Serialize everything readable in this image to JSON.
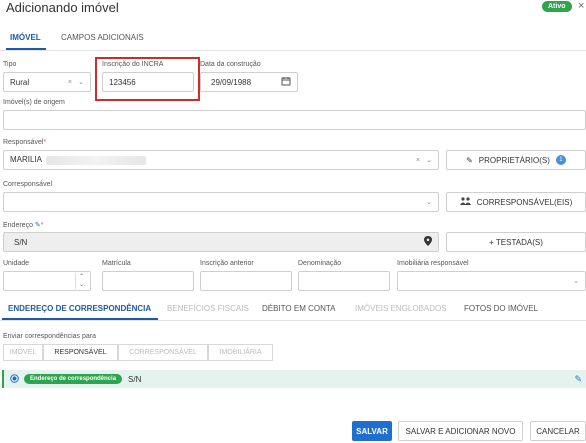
{
  "header": {
    "title": "Adicionando imóvel",
    "status_badge": "Ativo",
    "close_icon": "×"
  },
  "tabs_top": [
    {
      "label": "IMÓVEL",
      "active": true
    },
    {
      "label": "CAMPOS ADICIONAIS",
      "active": false
    }
  ],
  "form": {
    "tipo": {
      "label": "Tipo",
      "value": "Rural"
    },
    "incra": {
      "label": "Inscrição do INCRA",
      "value": "123456"
    },
    "data_construcao": {
      "label": "Data da construção",
      "value": "29/09/1988"
    },
    "imoveis_origem": {
      "label": "Imóvel(s) de origem",
      "value": ""
    },
    "responsavel": {
      "label": "Responsável",
      "required_mark": "*",
      "value": "MARILIA"
    },
    "proprietarios_button": {
      "label": "PROPRIETÁRIO(S)",
      "count": "1"
    },
    "corresponsavel": {
      "label": "Corresponsável",
      "value": ""
    },
    "corresponsaveis_button": {
      "label": "CORRESPONSÁVEL(EIS)"
    },
    "endereco": {
      "label": "Endereço",
      "required_mark": "*",
      "value": "S/N"
    },
    "testadas_button": {
      "label": "+ TESTADA(S)"
    },
    "unidade": {
      "label": "Unidade",
      "value": ""
    },
    "matricula": {
      "label": "Matrícula",
      "value": ""
    },
    "inscricao_anterior": {
      "label": "Inscrição anterior",
      "value": ""
    },
    "denominacao": {
      "label": "Denominação",
      "value": ""
    },
    "imobiliaria": {
      "label": "Imobiliária responsável",
      "value": ""
    }
  },
  "tabs_section": [
    {
      "label": "ENDEREÇO DE CORRESPONDÊNCIA",
      "active": true,
      "enabled": true
    },
    {
      "label": "BENEFÍCIOS FISCAIS",
      "active": false,
      "enabled": false
    },
    {
      "label": "DÉBITO EM CONTA",
      "active": false,
      "enabled": true
    },
    {
      "label": "IMÓVEIS ENGLOBADOS",
      "active": false,
      "enabled": false
    },
    {
      "label": "FOTOS DO IMÓVEL",
      "active": false,
      "enabled": true
    }
  ],
  "correspondence": {
    "label": "Enviar correspondências para",
    "options": [
      {
        "label": "IMÓVEL",
        "active": false
      },
      {
        "label": "RESPONSÁVEL",
        "active": true
      },
      {
        "label": "CORRESPONSÁVEL",
        "active": false
      },
      {
        "label": "IMOBILIÁRIA",
        "active": false
      }
    ],
    "address_pill": "Endereço de correspondência",
    "address_value": "S/N"
  },
  "footer": {
    "save": "SALVAR",
    "save_new": "SALVAR E ADICIONAR NOVO",
    "cancel": "CANCELAR"
  },
  "colors": {
    "primary": "#1f6fd1",
    "success": "#2ea44f",
    "highlight": "#d22a2a"
  },
  "icons": [
    "calendar-icon",
    "map-pin-icon",
    "pencil-icon",
    "user-group-icon",
    "radio-icon",
    "chevron-down-icon",
    "clear-icon"
  ]
}
